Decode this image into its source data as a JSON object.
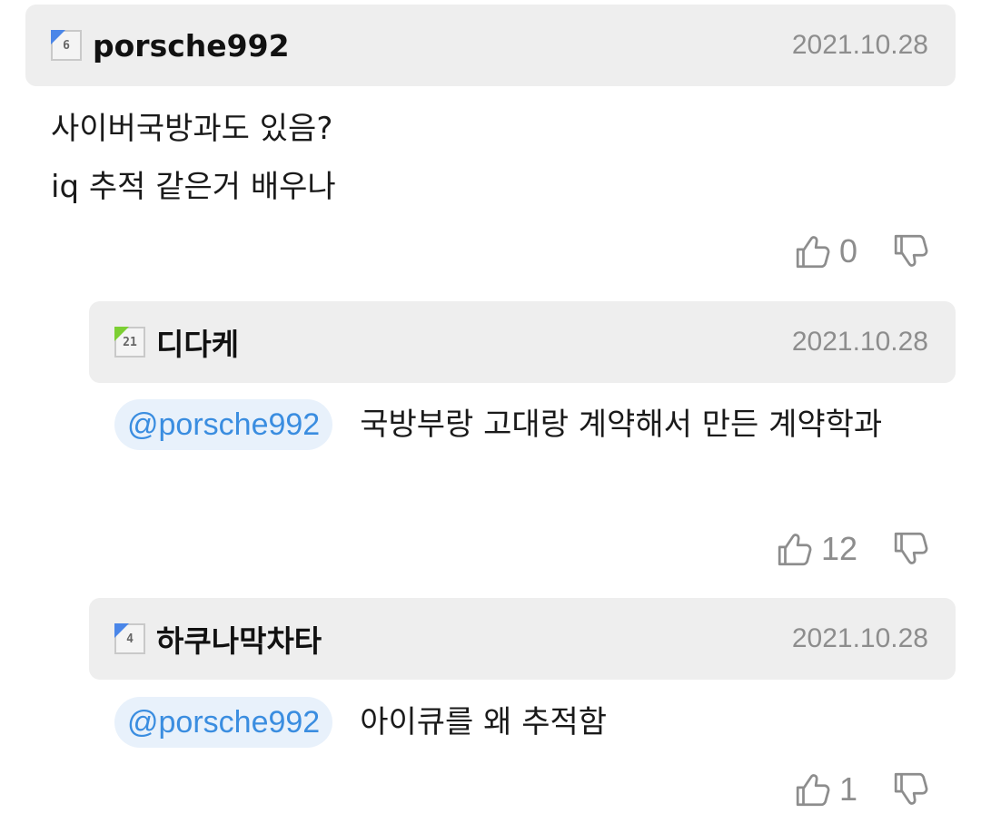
{
  "comments": [
    {
      "level": "6",
      "level_color": "#4a86e8",
      "username": "porsche992",
      "date": "2021.10.28",
      "lines": [
        "사이버국방과도 있음?",
        "iq 추적 같은거 배우나"
      ],
      "likes": "0"
    },
    {
      "level": "21",
      "level_color": "#7ccf33",
      "username": "디다케",
      "date": "2021.10.28",
      "mention": "@porsche992",
      "text": "국방부랑 고대랑 계약해서 만든 계약학과",
      "likes": "12"
    },
    {
      "level": "4",
      "level_color": "#4a86e8",
      "username": "하쿠나막차타",
      "date": "2021.10.28",
      "mention": "@porsche992",
      "text": "아이큐를 왜 추적함",
      "likes": "1"
    }
  ],
  "icons": {
    "like": "thumbs-up-icon",
    "dislike": "thumbs-down-icon"
  }
}
